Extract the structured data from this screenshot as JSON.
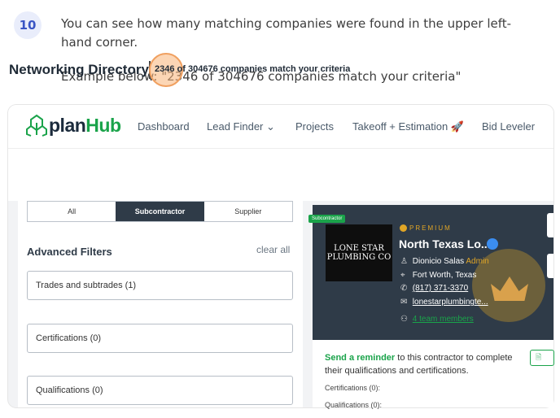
{
  "step": {
    "number": "10",
    "instruction": "You can see how many matching companies were found in the upper left-hand corner.",
    "example": "Example below: \"2346 of 304676 companies match your criteria\""
  },
  "nav": {
    "logo_plan": "plan",
    "logo_hub": "Hub",
    "items": [
      "Dashboard",
      "Lead Finder",
      "Projects",
      "Takeoff + Estimation",
      "Bid Leveler"
    ]
  },
  "directory": {
    "title": "Networking Directory",
    "count": "2346",
    "match_rest": "of 304676 companies match your criteria"
  },
  "filters": {
    "segments": [
      "All",
      "Subcontractor",
      "Supplier"
    ],
    "active_segment": "Subcontractor",
    "advanced_label": "Advanced Filters",
    "clear_all": "clear all",
    "boxes": [
      "Trades and subtrades (1)",
      "Certifications (0)",
      "Qualifications (0)"
    ]
  },
  "card": {
    "badge": "Subcontractor",
    "logo_text": "LONE STAR PLUMBING CO",
    "premium": "PREMIUM",
    "company": "North Texas Lo...",
    "contact": "Dionicio Salas",
    "contact_role": "Admin",
    "location": "Fort Worth, Texas",
    "phone": "(817) 371-3370",
    "website": "lonestarplumbingte...",
    "team": "4 team members",
    "reminder_bold": "Send a reminder",
    "reminder_rest": " to this contractor to complete their qualifications and certifications.",
    "certs": "Certifications (0):",
    "quals": "Qualifications (0):"
  },
  "colors": {
    "brand_green": "#1aa34a",
    "brand_dark": "#1b2b3c",
    "badge_bg": "#e9edfb",
    "badge_fg": "#3a55c4",
    "premium_gold": "#e0a526"
  }
}
